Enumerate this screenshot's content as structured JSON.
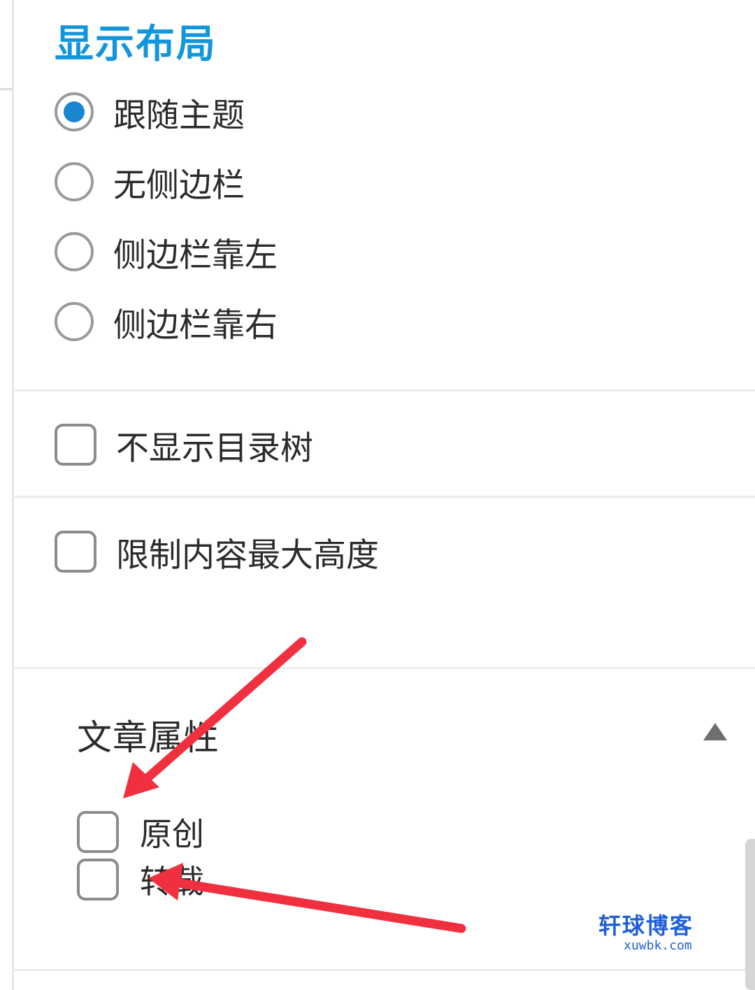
{
  "layout_section": {
    "title": "显示布局",
    "options": [
      {
        "label": "跟随主题",
        "selected": true
      },
      {
        "label": "无侧边栏",
        "selected": false
      },
      {
        "label": "侧边栏靠左",
        "selected": false
      },
      {
        "label": "侧边栏靠右",
        "selected": false
      }
    ]
  },
  "toggles": [
    {
      "label": "不显示目录树",
      "checked": false
    },
    {
      "label": "限制内容最大高度",
      "checked": false
    }
  ],
  "article_attributes": {
    "title": "文章属性",
    "expanded": true,
    "options": [
      {
        "label": "原创",
        "checked": false
      },
      {
        "label": "转载",
        "checked": false
      }
    ]
  },
  "watermark": {
    "brand": "轩球博客",
    "domain": "xuwbk.com"
  },
  "colors": {
    "accent": "#1296db",
    "radio_selected": "#1a86cf",
    "annotation_arrow": "#f0303f",
    "watermark": "#1f5fd6"
  },
  "icons": {
    "collapse": "triangle-up-icon"
  }
}
